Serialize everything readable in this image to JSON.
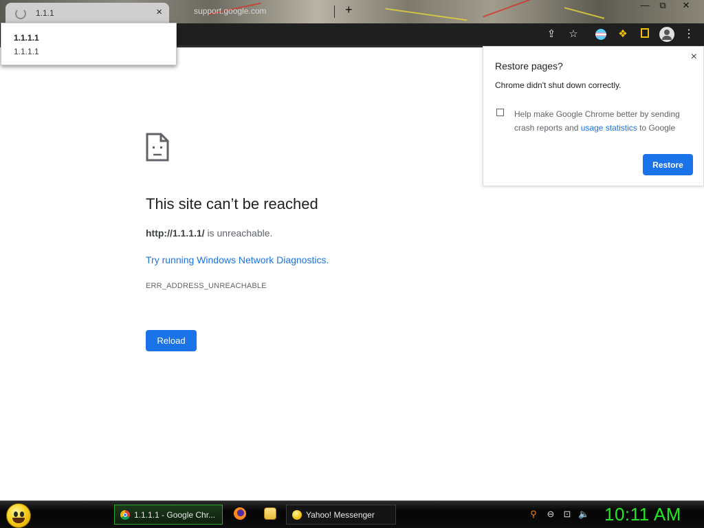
{
  "browser": {
    "active_tab": {
      "title": "1.1.1",
      "close": "×"
    },
    "inactive_tab": {
      "title": "support.google.com"
    },
    "new_tab": "+",
    "window_controls": {
      "minimize": "—",
      "maximize": "⧉",
      "close": "✕"
    },
    "toolbar": {
      "share": "⇪",
      "bookmark": "☆",
      "menu": "⋮"
    }
  },
  "tooltip": {
    "title": "1.1.1.1",
    "url": "1.1.1.1"
  },
  "error_page": {
    "title": "This site can’t be reached",
    "url": "http://1.1.1.1/",
    "unreachable_suffix": " is unreachable.",
    "suggestion_link": "Try running Windows Network Diagnostics.",
    "error_code": "ERR_ADDRESS_UNREACHABLE",
    "reload_label": "Reload"
  },
  "restore_bubble": {
    "title": "Restore pages?",
    "message": "Chrome didn't shut down correctly.",
    "help_prefix": "Help make Google Chrome better by sending crash reports and ",
    "help_link": "usage statistics",
    "help_suffix": " to Google",
    "close": "×",
    "restore_label": "Restore"
  },
  "taskbar": {
    "items": [
      {
        "label": "1.1.1.1 - Google Chr..."
      },
      {
        "label": "Yahoo! Messenger"
      }
    ],
    "tray": {
      "search": "⚲",
      "minus": "⊖",
      "network": "⊡",
      "volume": "🔈"
    },
    "clock": "10:11 AM"
  },
  "colors": {
    "accent": "#1a73e8",
    "clock": "#22e822",
    "toolbar": "#1f1f1f"
  }
}
